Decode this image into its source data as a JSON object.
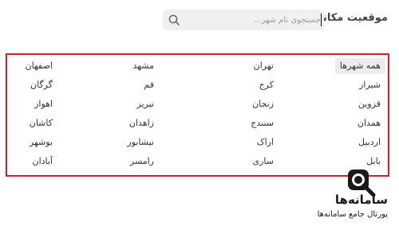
{
  "header": {
    "title": "موقعیت مکانی"
  },
  "search": {
    "placeholder": "جستجوی نام شهر...",
    "value": "",
    "icon": "search-icon"
  },
  "cities": {
    "columns": [
      [
        "همه شهرها",
        "شیراز",
        "قزوین",
        "همدان",
        "اردبیل",
        "بابل"
      ],
      [
        "تهران",
        "کرج",
        "زنجان",
        "سنندج",
        "اراک",
        "ساری"
      ],
      [
        "مشهد",
        "قم",
        "تبریز",
        "زاهدان",
        "نیشابور",
        "رامسر"
      ],
      [
        "اصفهان",
        "گرگان",
        "اهواز",
        "کاشان",
        "بوشهر",
        "آبادان"
      ]
    ],
    "selected": "همه شهرها"
  },
  "branding": {
    "name": "سامانه‌ها",
    "tagline": "پورتال جامع سامانه‌ها"
  },
  "colors": {
    "panel_border": "#cf1f2e",
    "selected_bg": "#ececef",
    "search_bg": "#f0f0f2"
  }
}
